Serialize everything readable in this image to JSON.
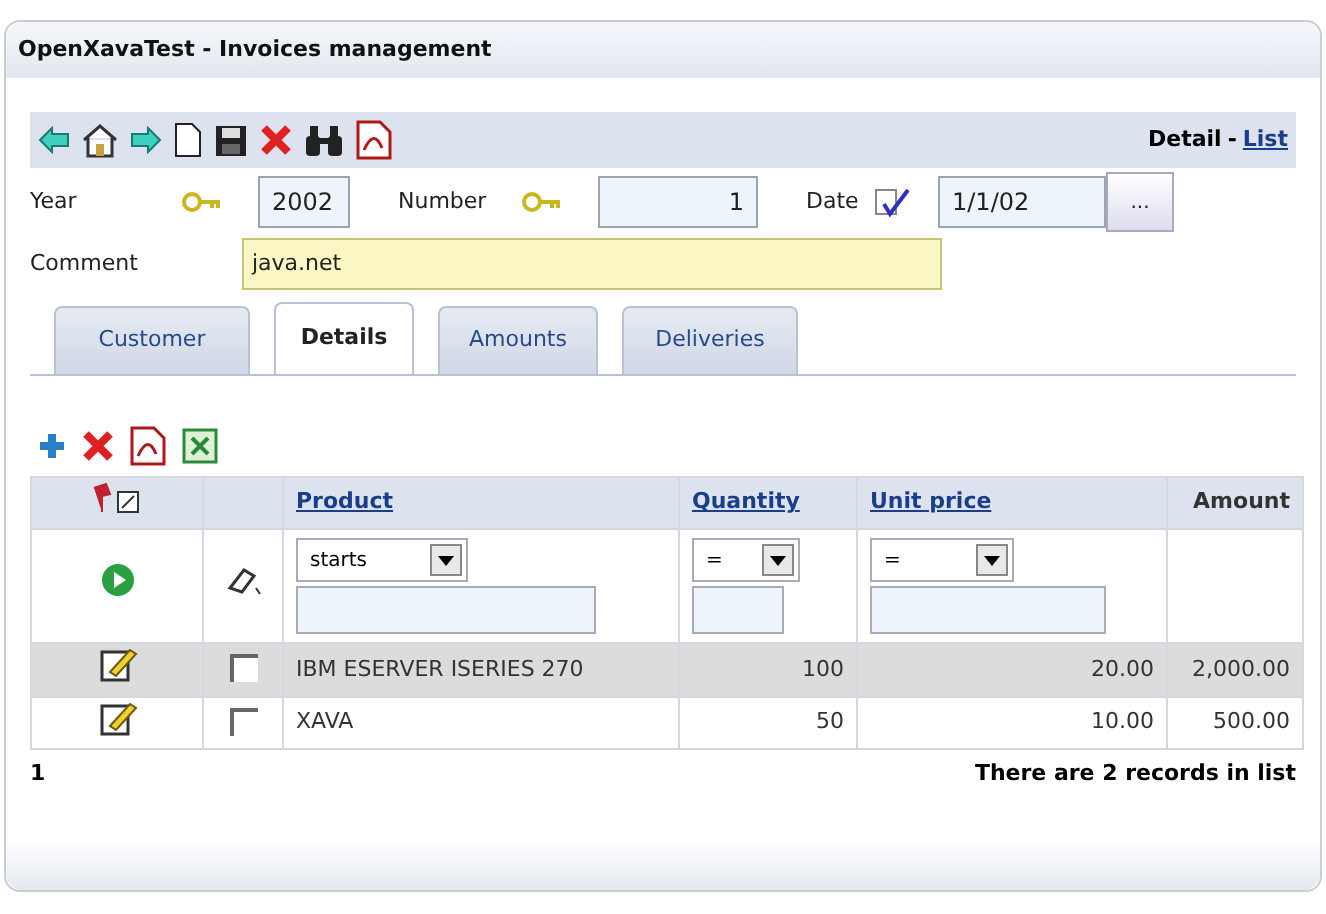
{
  "window": {
    "title": "OpenXavaTest - Invoices management"
  },
  "toolbar": {
    "mode": "Detail",
    "separator": "-",
    "list_link": "List"
  },
  "fields": [
    {
      "kind": "key",
      "label": "Year",
      "value": "2002"
    },
    {
      "kind": "key",
      "label": "Number",
      "value": "1"
    },
    {
      "kind": "date",
      "label": "Date",
      "value": "1/1/02",
      "button": "..."
    }
  ],
  "comment": {
    "label": "Comment",
    "value": "java.net"
  },
  "tabs": [
    {
      "label": "Customer",
      "selected": false
    },
    {
      "label": "Details",
      "selected": true
    },
    {
      "label": "Amounts",
      "selected": false
    },
    {
      "label": "Deliveries",
      "selected": false
    }
  ],
  "table": {
    "columns": [
      {
        "label": "Product",
        "link": true
      },
      {
        "label": "Quantity",
        "link": true
      },
      {
        "label": "Unit price",
        "link": true
      },
      {
        "label": "Amount",
        "link": false
      }
    ],
    "filters": [
      {
        "operator": "starts"
      },
      {
        "operator": "="
      },
      {
        "operator": "="
      }
    ],
    "rows": [
      {
        "checked": false,
        "cells": [
          "IBM ESERVER ISERIES 270",
          "100",
          "20.00",
          "2,000.00"
        ]
      },
      {
        "checked": false,
        "cells": [
          "XAVA",
          "50",
          "10.00",
          "500.00"
        ]
      }
    ]
  },
  "footer": {
    "page": "1",
    "summary": "There are 2 records in list"
  }
}
